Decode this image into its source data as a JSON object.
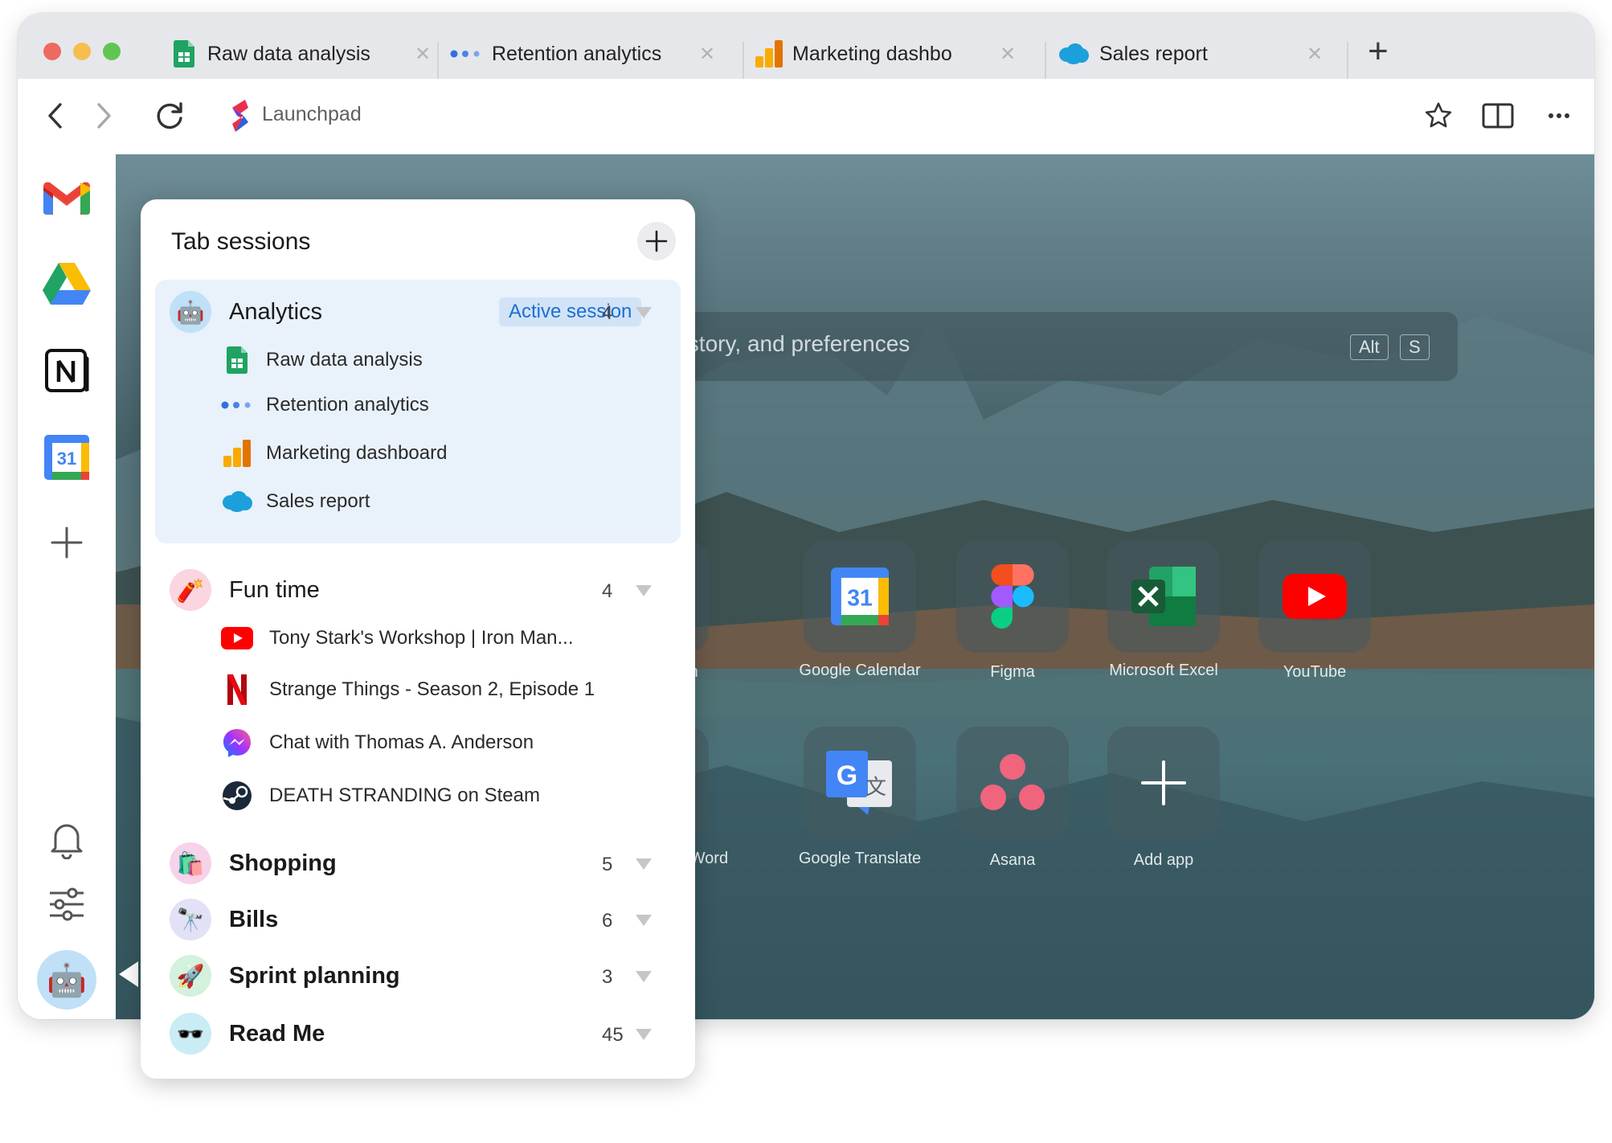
{
  "browser": {
    "tabs": [
      {
        "label": "Raw data analysis",
        "icon": "google-sheets-icon"
      },
      {
        "label": "Retention analytics",
        "icon": "dots-icon"
      },
      {
        "label": "Marketing dashbo",
        "icon": "analytics-icon"
      },
      {
        "label": "Sales report",
        "icon": "salesforce-icon"
      }
    ],
    "close_glyph": "✕",
    "new_tab_glyph": "+",
    "address": "Launchpad"
  },
  "search": {
    "placeholder": "history, and preferences",
    "shortcut_1": "Alt",
    "shortcut_2": "S"
  },
  "apps": [
    {
      "label": "ion"
    },
    {
      "label": "Google Calendar"
    },
    {
      "label": "Figma"
    },
    {
      "label": "Microsoft Excel"
    },
    {
      "label": "YouTube"
    },
    {
      "label": "ft Word"
    },
    {
      "label": "Google Translate"
    },
    {
      "label": "Asana"
    },
    {
      "label": "Add app"
    }
  ],
  "panel": {
    "title": "Tab sessions",
    "active_badge": "Active session",
    "sessions": [
      {
        "name": "Analytics",
        "count": "4",
        "avatar": "🤖",
        "tabs": [
          "Raw data analysis",
          "Retention analytics",
          "Marketing dashboard",
          "Sales report"
        ]
      },
      {
        "name": "Fun time",
        "count": "4",
        "avatar": "🧨",
        "tabs": [
          "Tony Stark's Workshop | Iron Man...",
          "Strange Things - Season 2, Episode 1",
          "Chat with Thomas A. Anderson",
          "DEATH STRANDING on Steam"
        ]
      },
      {
        "name": "Shopping",
        "count": "5",
        "avatar": "🛍️"
      },
      {
        "name": "Bills",
        "count": "6",
        "avatar": "🔭"
      },
      {
        "name": "Sprint planning",
        "count": "3",
        "avatar": "🚀"
      },
      {
        "name": "Read Me",
        "count": "45",
        "avatar": "🕶️"
      }
    ]
  },
  "sidebar_apps": [
    {
      "label": "M",
      "icon": "gmail-icon"
    },
    {
      "label": "N",
      "icon": "notion-icon"
    },
    {
      "label": "31",
      "icon": "google-calendar-icon"
    }
  ],
  "colors": {
    "accent": "#1a6fd1",
    "active_bg": "#e9f1fb"
  }
}
